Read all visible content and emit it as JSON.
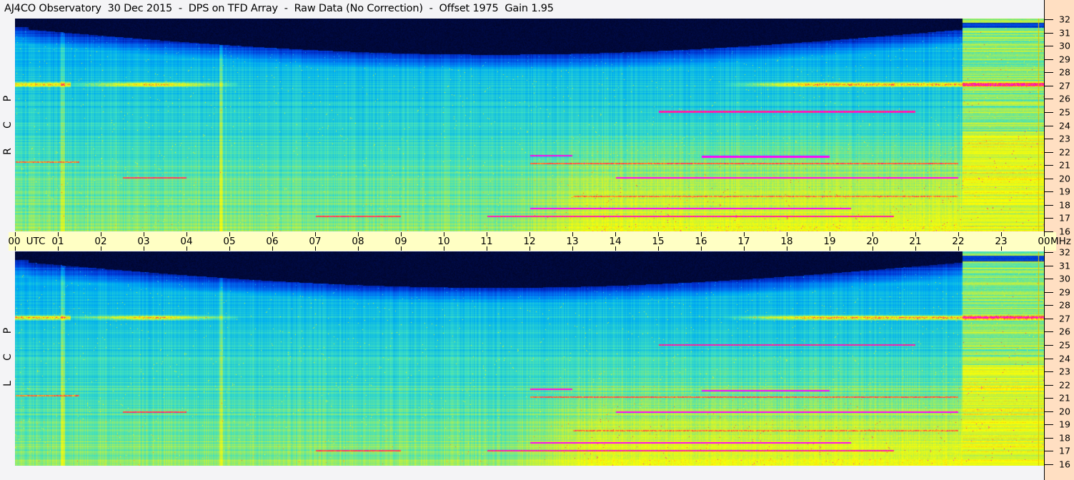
{
  "title": "AJ4CO Observatory  30 Dec 2015  -  DPS on TFD Array  -  Raw Data (No Correction)  -  Offset 1975  Gain 1.95",
  "colors": {
    "background": "#f4f4f6",
    "time_axis_band": "#ffffc4",
    "freq_axis_strip": "#ffdfc2"
  },
  "chart_data": [
    {
      "type": "heatmap",
      "panel_label": [
        "R",
        "C",
        "P"
      ],
      "x_ticks": [
        "00",
        "01",
        "02",
        "03",
        "04",
        "05",
        "06",
        "07",
        "08",
        "09",
        "10",
        "11",
        "12",
        "13",
        "14",
        "15",
        "16",
        "17",
        "18",
        "19",
        "20",
        "21",
        "22",
        "23",
        "00"
      ],
      "x_unit": "UTC",
      "y_ticks": [
        "32",
        "31",
        "30",
        "29",
        "28",
        "27",
        "26",
        "25",
        "24",
        "23",
        "22",
        "21",
        "20",
        "19",
        "18",
        "17",
        "16"
      ],
      "y_unit": "MHz",
      "xlim": [
        0,
        24
      ],
      "ylim": [
        16,
        32
      ],
      "colormap": [
        "#000010",
        "#001060",
        "#0030d0",
        "#0070f0",
        "#00b0f0",
        "#40e0c0",
        "#c0f040",
        "#ffff00",
        "#ff4040",
        "#ff00ff"
      ]
    },
    {
      "type": "heatmap",
      "panel_label": [
        "L",
        "C",
        "P"
      ],
      "x_ticks": [
        "00",
        "01",
        "02",
        "03",
        "04",
        "05",
        "06",
        "07",
        "08",
        "09",
        "10",
        "11",
        "12",
        "13",
        "14",
        "15",
        "16",
        "17",
        "18",
        "19",
        "20",
        "21",
        "22",
        "23",
        "00"
      ],
      "x_unit": "UTC",
      "y_ticks": [
        "32",
        "31",
        "30",
        "29",
        "28",
        "27",
        "26",
        "25",
        "24",
        "23",
        "22",
        "21",
        "20",
        "19",
        "18",
        "17",
        "16"
      ],
      "y_unit": "MHz",
      "xlim": [
        0,
        24
      ],
      "ylim": [
        16,
        32
      ],
      "colormap": [
        "#000010",
        "#001060",
        "#0030d0",
        "#0070f0",
        "#00b0f0",
        "#40e0c0",
        "#c0f040",
        "#ffff00",
        "#ff4040",
        "#ff00ff"
      ]
    }
  ]
}
